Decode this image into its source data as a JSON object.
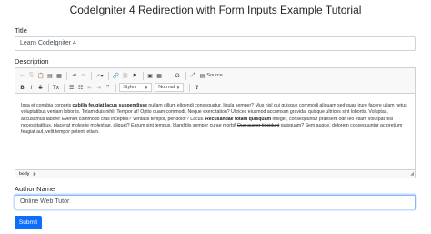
{
  "page": {
    "title": "CodeIgniter 4 Redirection with Form Inputs Example Tutorial"
  },
  "form": {
    "title_label": "Title",
    "title_value": "Learn CodeIgniter 4",
    "description_label": "Description",
    "author_label": "Author Name",
    "author_value": "Online Web Tutor",
    "submit_label": "Submit"
  },
  "editor": {
    "toolbar": {
      "source_label": "Source",
      "styles_label": "Styles",
      "format_label": "Normal",
      "help_label": "?"
    },
    "content": {
      "t1": "Ipsa et conubia corporis ",
      "b1": "cubilia feugiat lacus suspendisse",
      "t2": " nullam cillum eligendi consequatur, ligula semper? Mus nisl qui quisque commodi aliquam sed quas irure facere ullam netus voluptatibus veniam lobortis. Totam duis nihil. Tempor at! Optio quam commodi. Neque exercitation? Ultrices eiusmod accumsan gravida, quisque ultrices sint lobortis. Voluptas, accusamus labore! Eveniet commodo cras inceptos? Ventatis tempor, per dolor? Lacus. ",
      "b2": "Recusandae totam quisquam",
      "t3": " integer, consequuntur praesent odit leo etiam volutpat nisi necessitatibus, placerat molestie molestiae, aliquet? Earum sint tempus, blanditiis semper curae morbi! ",
      "s1": "Quo auctor tincidunt",
      "t4": " quisquam? Sem augue, dolorem consequuntur ac pretium feugiat aut, velit tempor potenti etiam."
    },
    "status_path": [
      "body",
      "p"
    ]
  }
}
